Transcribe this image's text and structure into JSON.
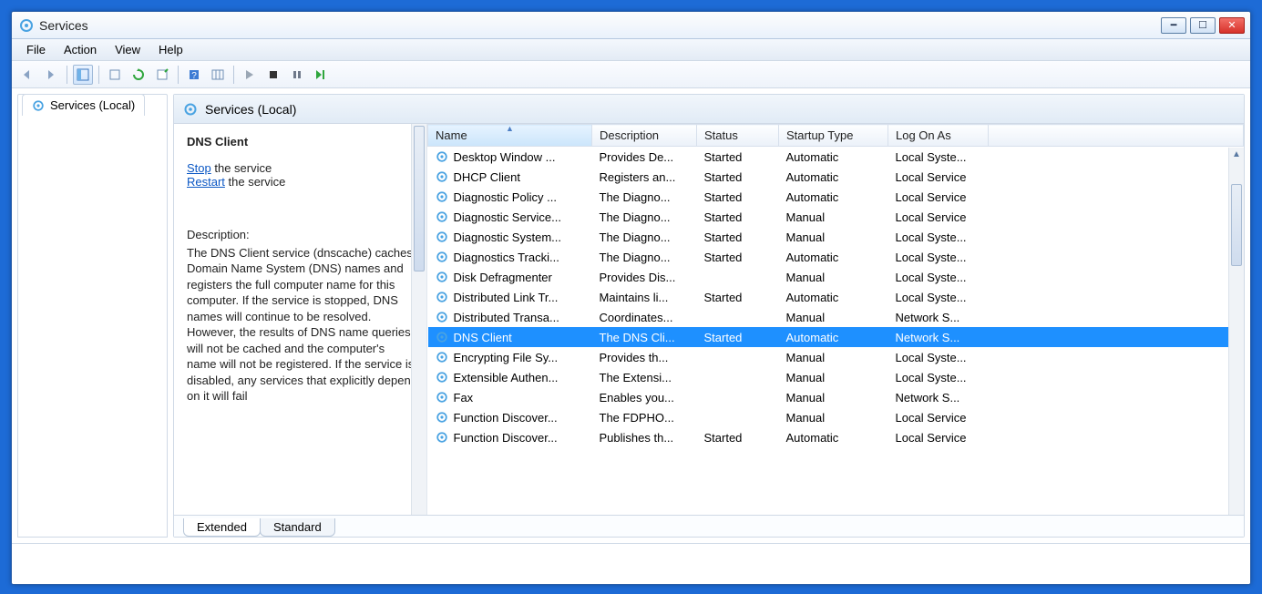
{
  "window": {
    "title": "Services"
  },
  "menu": {
    "file": "File",
    "action": "Action",
    "view": "View",
    "help": "Help"
  },
  "nav": {
    "label": "Services (Local)"
  },
  "main_header": "Services (Local)",
  "detail": {
    "title": "DNS Client",
    "stop_label": "Stop",
    "stop_suffix": " the service",
    "restart_label": "Restart",
    "restart_suffix": " the service",
    "desc_label": "Description:",
    "description": "The DNS Client service (dnscache) caches Domain Name System (DNS) names and registers the full computer name for this computer. If the service is stopped, DNS names will continue to be resolved. However, the results of DNS name queries will not be cached and the computer's name will not be registered. If the service is disabled, any services that explicitly depend on it will fail"
  },
  "columns": {
    "name": "Name",
    "description": "Description",
    "status": "Status",
    "startup": "Startup Type",
    "logon": "Log On As"
  },
  "rows": [
    {
      "name": "Desktop Window ...",
      "description": "Provides De...",
      "status": "Started",
      "startup": "Automatic",
      "logon": "Local Syste..."
    },
    {
      "name": "DHCP Client",
      "description": "Registers an...",
      "status": "Started",
      "startup": "Automatic",
      "logon": "Local Service"
    },
    {
      "name": "Diagnostic Policy ...",
      "description": "The Diagno...",
      "status": "Started",
      "startup": "Automatic",
      "logon": "Local Service"
    },
    {
      "name": "Diagnostic Service...",
      "description": "The Diagno...",
      "status": "Started",
      "startup": "Manual",
      "logon": "Local Service"
    },
    {
      "name": "Diagnostic System...",
      "description": "The Diagno...",
      "status": "Started",
      "startup": "Manual",
      "logon": "Local Syste..."
    },
    {
      "name": "Diagnostics Tracki...",
      "description": "The Diagno...",
      "status": "Started",
      "startup": "Automatic",
      "logon": "Local Syste..."
    },
    {
      "name": "Disk Defragmenter",
      "description": "Provides Dis...",
      "status": "",
      "startup": "Manual",
      "logon": "Local Syste..."
    },
    {
      "name": "Distributed Link Tr...",
      "description": "Maintains li...",
      "status": "Started",
      "startup": "Automatic",
      "logon": "Local Syste..."
    },
    {
      "name": "Distributed Transa...",
      "description": "Coordinates...",
      "status": "",
      "startup": "Manual",
      "logon": "Network S..."
    },
    {
      "name": "DNS Client",
      "description": "The DNS Cli...",
      "status": "Started",
      "startup": "Automatic",
      "logon": "Network S...",
      "selected": true
    },
    {
      "name": "Encrypting File Sy...",
      "description": "Provides th...",
      "status": "",
      "startup": "Manual",
      "logon": "Local Syste..."
    },
    {
      "name": "Extensible Authen...",
      "description": "The Extensi...",
      "status": "",
      "startup": "Manual",
      "logon": "Local Syste..."
    },
    {
      "name": "Fax",
      "description": "Enables you...",
      "status": "",
      "startup": "Manual",
      "logon": "Network S..."
    },
    {
      "name": "Function Discover...",
      "description": "The FDPHO...",
      "status": "",
      "startup": "Manual",
      "logon": "Local Service"
    },
    {
      "name": "Function Discover...",
      "description": "Publishes th...",
      "status": "Started",
      "startup": "Automatic",
      "logon": "Local Service"
    }
  ],
  "bottom_tabs": {
    "extended": "Extended",
    "standard": "Standard"
  }
}
